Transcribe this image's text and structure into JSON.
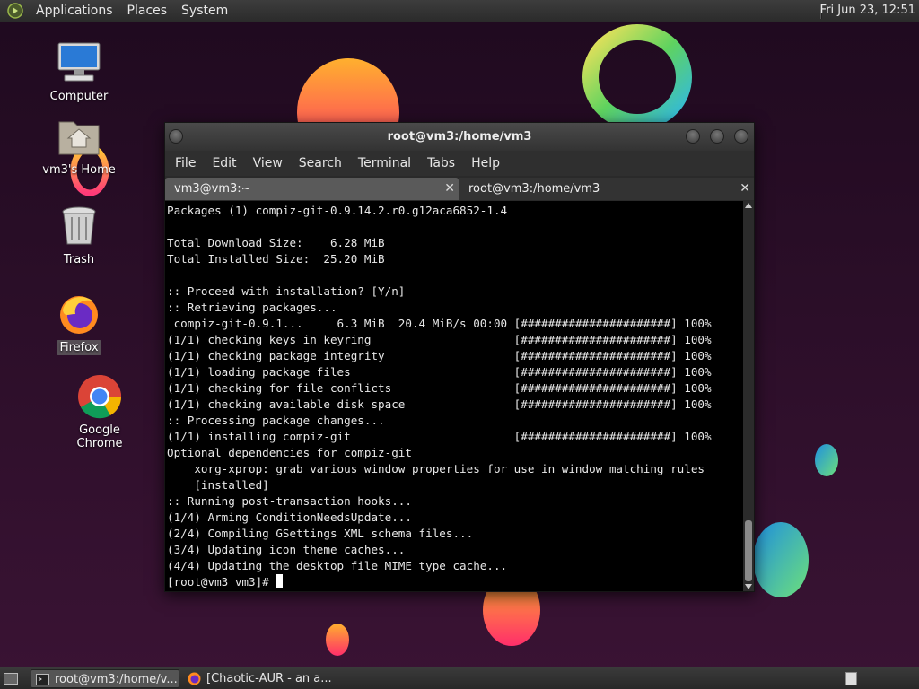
{
  "top_panel": {
    "menus": [
      "Applications",
      "Places",
      "System"
    ],
    "clock": "Fri Jun 23, 12:51"
  },
  "desktop_icons": {
    "computer": "Computer",
    "home": "vm3's Home",
    "trash": "Trash",
    "firefox": "Firefox",
    "chrome": "Google Chrome"
  },
  "terminal": {
    "title": "root@vm3:/home/vm3",
    "menu": [
      "File",
      "Edit",
      "View",
      "Search",
      "Terminal",
      "Tabs",
      "Help"
    ],
    "tabs": [
      {
        "label": "vm3@vm3:~"
      },
      {
        "label": "root@vm3:/home/vm3"
      }
    ],
    "lines": [
      "Packages (1) compiz-git-0.9.14.2.r0.g12aca6852-1.4",
      "",
      "Total Download Size:    6.28 MiB",
      "Total Installed Size:  25.20 MiB",
      "",
      ":: Proceed with installation? [Y/n]",
      ":: Retrieving packages...",
      " compiz-git-0.9.1...     6.3 MiB  20.4 MiB/s 00:00 [######################] 100%",
      "(1/1) checking keys in keyring                     [######################] 100%",
      "(1/1) checking package integrity                   [######################] 100%",
      "(1/1) loading package files                        [######################] 100%",
      "(1/1) checking for file conflicts                  [######################] 100%",
      "(1/1) checking available disk space                [######################] 100%",
      ":: Processing package changes...",
      "(1/1) installing compiz-git                        [######################] 100%",
      "Optional dependencies for compiz-git",
      "    xorg-xprop: grab various window properties for use in window matching rules",
      "    [installed]",
      ":: Running post-transaction hooks...",
      "(1/4) Arming ConditionNeedsUpdate...",
      "(2/4) Compiling GSettings XML schema files...",
      "(3/4) Updating icon theme caches...",
      "(4/4) Updating the desktop file MIME type cache..."
    ],
    "prompt": "[root@vm3 vm3]# "
  },
  "taskbar": {
    "tasks": [
      {
        "label": "root@vm3:/home/v..."
      },
      {
        "label": "[Chaotic-AUR - an a..."
      }
    ]
  }
}
